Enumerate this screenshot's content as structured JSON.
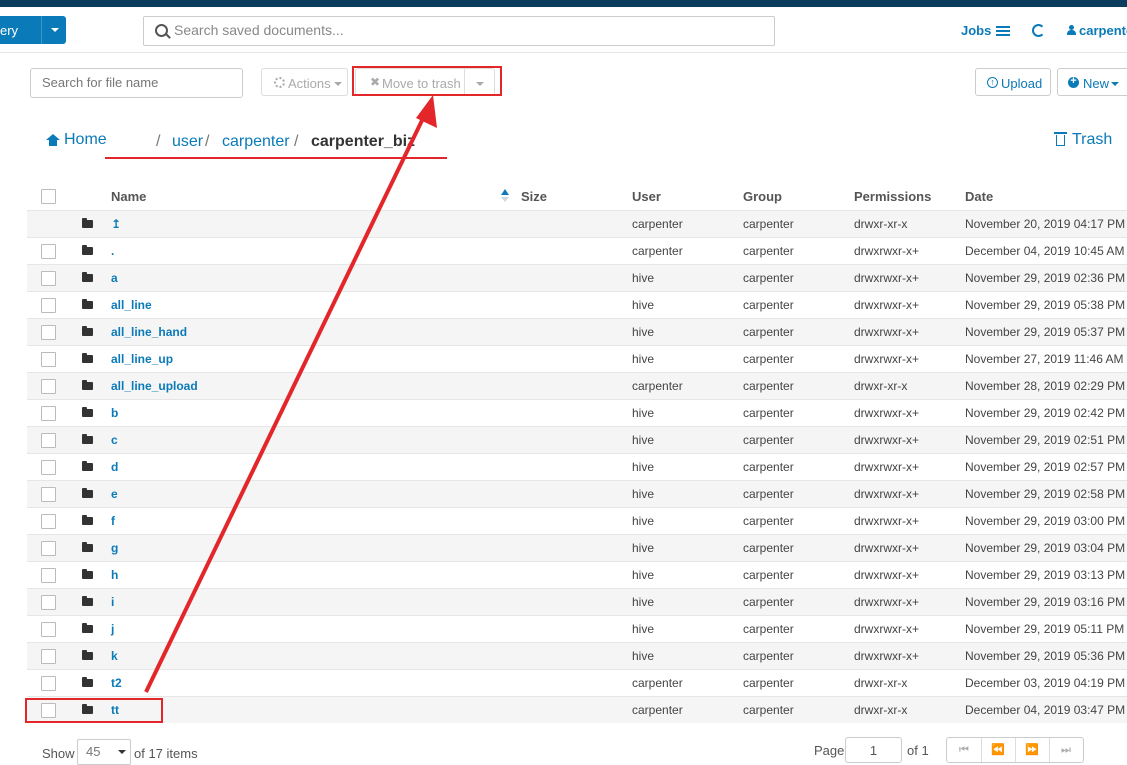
{
  "header": {
    "query_label": "ery",
    "search_placeholder": "Search saved documents...",
    "jobs_label": "Jobs",
    "username": "carpente"
  },
  "toolbar": {
    "filter_placeholder": "Search for file name",
    "actions_label": "Actions",
    "move_to_trash_label": "Move to trash",
    "upload_label": "Upload",
    "new_label": "New"
  },
  "breadcrumb": {
    "home_label": "Home",
    "items": [
      "user",
      "carpenter",
      "carpenter_biz"
    ],
    "trash_label": "Trash"
  },
  "table": {
    "columns": [
      "Name",
      "Size",
      "User",
      "Group",
      "Permissions",
      "Date"
    ],
    "rows": [
      {
        "name": "↥",
        "size": "",
        "user": "carpenter",
        "group": "carpenter",
        "permissions": "drwxr-xr-x",
        "date": "November 20, 2019 04:17 PM"
      },
      {
        "name": ".",
        "size": "",
        "user": "carpenter",
        "group": "carpenter",
        "permissions": "drwxrwxr-x+",
        "date": "December 04, 2019 10:45 AM"
      },
      {
        "name": "a",
        "size": "",
        "user": "hive",
        "group": "carpenter",
        "permissions": "drwxrwxr-x+",
        "date": "November 29, 2019 02:36 PM"
      },
      {
        "name": "all_line",
        "size": "",
        "user": "hive",
        "group": "carpenter",
        "permissions": "drwxrwxr-x+",
        "date": "November 29, 2019 05:38 PM"
      },
      {
        "name": "all_line_hand",
        "size": "",
        "user": "hive",
        "group": "carpenter",
        "permissions": "drwxrwxr-x+",
        "date": "November 29, 2019 05:37 PM"
      },
      {
        "name": "all_line_up",
        "size": "",
        "user": "hive",
        "group": "carpenter",
        "permissions": "drwxrwxr-x+",
        "date": "November 27, 2019 11:46 AM"
      },
      {
        "name": "all_line_upload",
        "size": "",
        "user": "carpenter",
        "group": "carpenter",
        "permissions": "drwxr-xr-x",
        "date": "November 28, 2019 02:29 PM"
      },
      {
        "name": "b",
        "size": "",
        "user": "hive",
        "group": "carpenter",
        "permissions": "drwxrwxr-x+",
        "date": "November 29, 2019 02:42 PM"
      },
      {
        "name": "c",
        "size": "",
        "user": "hive",
        "group": "carpenter",
        "permissions": "drwxrwxr-x+",
        "date": "November 29, 2019 02:51 PM"
      },
      {
        "name": "d",
        "size": "",
        "user": "hive",
        "group": "carpenter",
        "permissions": "drwxrwxr-x+",
        "date": "November 29, 2019 02:57 PM"
      },
      {
        "name": "e",
        "size": "",
        "user": "hive",
        "group": "carpenter",
        "permissions": "drwxrwxr-x+",
        "date": "November 29, 2019 02:58 PM"
      },
      {
        "name": "f",
        "size": "",
        "user": "hive",
        "group": "carpenter",
        "permissions": "drwxrwxr-x+",
        "date": "November 29, 2019 03:00 PM"
      },
      {
        "name": "g",
        "size": "",
        "user": "hive",
        "group": "carpenter",
        "permissions": "drwxrwxr-x+",
        "date": "November 29, 2019 03:04 PM"
      },
      {
        "name": "h",
        "size": "",
        "user": "hive",
        "group": "carpenter",
        "permissions": "drwxrwxr-x+",
        "date": "November 29, 2019 03:13 PM"
      },
      {
        "name": "i",
        "size": "",
        "user": "hive",
        "group": "carpenter",
        "permissions": "drwxrwxr-x+",
        "date": "November 29, 2019 03:16 PM"
      },
      {
        "name": "j",
        "size": "",
        "user": "hive",
        "group": "carpenter",
        "permissions": "drwxrwxr-x+",
        "date": "November 29, 2019 05:11 PM"
      },
      {
        "name": "k",
        "size": "",
        "user": "hive",
        "group": "carpenter",
        "permissions": "drwxrwxr-x+",
        "date": "November 29, 2019 05:36 PM"
      },
      {
        "name": "t2",
        "size": "",
        "user": "carpenter",
        "group": "carpenter",
        "permissions": "drwxr-xr-x",
        "date": "December 03, 2019 04:19 PM"
      },
      {
        "name": "tt",
        "size": "",
        "user": "carpenter",
        "group": "carpenter",
        "permissions": "drwxr-xr-x",
        "date": "December 04, 2019 03:47 PM"
      }
    ]
  },
  "footer": {
    "show_label": "Show",
    "page_size": "45",
    "of_items": "of 17 items",
    "page_label": "Page",
    "page_value": "1",
    "of_pages": "of 1"
  },
  "colors": {
    "accent": "#0b7ab8",
    "annotation": "#e3262a",
    "top_strip": "#0b3c5d"
  }
}
